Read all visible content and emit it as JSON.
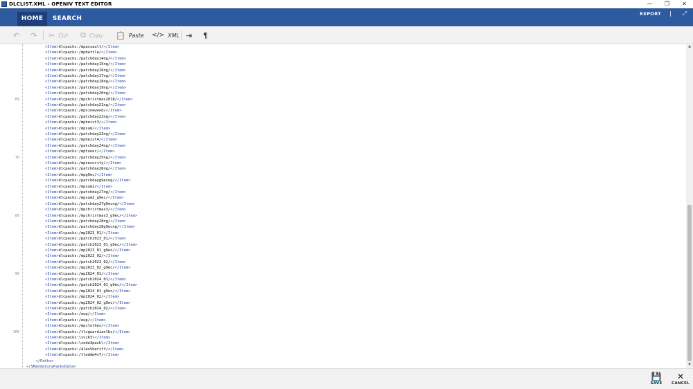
{
  "window": {
    "title": "DLCLIST.XML - OPENIV TEXT EDITOR",
    "minimize_glyph": "—",
    "restore_glyph": "❐",
    "close_glyph": "✕"
  },
  "ribbon": {
    "tabs": [
      {
        "label": "HOME"
      },
      {
        "label": "SEARCH"
      }
    ],
    "export_label": "EXPORT",
    "expand_glyph": "⤢"
  },
  "toolbar": {
    "undo_glyph": "↶",
    "redo_glyph": "↷",
    "cut_label": "Cut",
    "cut_glyph": "✂",
    "copy_label": "Copy",
    "copy_glyph": "⧉",
    "paste_label": "Paste",
    "paste_glyph": "📋",
    "xml_label": "XML",
    "xml_glyph": "</>",
    "wordwrap_glyph": "⇥",
    "pilcrow_glyph": "¶"
  },
  "editor": {
    "line_numbers": [
      "60",
      "70",
      "80",
      "90",
      "100"
    ],
    "lines": [
      {
        "indent": "      ",
        "open": "<Item>",
        "text": "dlcpacks:/mpassault/",
        "close": "</Item>"
      },
      {
        "indent": "      ",
        "open": "<Item>",
        "text": "dlcpacks:/mpbattle/",
        "close": "</Item>"
      },
      {
        "indent": "      ",
        "open": "<Item>",
        "text": "dlcpacks:/patchday14ng/",
        "close": "</Item>"
      },
      {
        "indent": "      ",
        "open": "<Item>",
        "text": "dlcpacks:/patchday15ng/",
        "close": "</Item>"
      },
      {
        "indent": "      ",
        "open": "<Item>",
        "text": "dlcpacks:/patchday16ng/",
        "close": "</Item>"
      },
      {
        "indent": "      ",
        "open": "<Item>",
        "text": "dlcpacks:/patchday17ng/",
        "close": "</Item>"
      },
      {
        "indent": "      ",
        "open": "<Item>",
        "text": "dlcpacks:/patchday18ng/",
        "close": "</Item>"
      },
      {
        "indent": "      ",
        "open": "<Item>",
        "text": "dlcpacks:/patchday19ng/",
        "close": "</Item>"
      },
      {
        "indent": "      ",
        "open": "<Item>",
        "text": "dlcpacks:/patchday20ng/",
        "close": "</Item>"
      },
      {
        "indent": "      ",
        "open": "<Item>",
        "text": "dlcpacks:/mpchristmas2018/",
        "close": "</Item>"
      },
      {
        "indent": "      ",
        "open": "<Item>",
        "text": "dlcpacks:/patchday21ng/",
        "close": "</Item>"
      },
      {
        "indent": "      ",
        "open": "<Item>",
        "text": "dlcpacks:/mpvinewood/",
        "close": "</Item>"
      },
      {
        "indent": "      ",
        "open": "<Item>",
        "text": "dlcpacks:/patchday22ng/",
        "close": "</Item>"
      },
      {
        "indent": "      ",
        "open": "<Item>",
        "text": "dlcpacks:/mpheist3/",
        "close": "</Item>"
      },
      {
        "indent": "      ",
        "open": "<Item>",
        "text": "dlcpacks:/mpsum/",
        "close": "</Item>"
      },
      {
        "indent": "      ",
        "open": "<Item>",
        "text": "dlcpacks:/patchday23ng/",
        "close": "</Item>"
      },
      {
        "indent": "      ",
        "open": "<Item>",
        "text": "dlcpacks:/mpheist4/",
        "close": "</Item>"
      },
      {
        "indent": "      ",
        "open": "<Item>",
        "text": "dlcpacks:/patchday24ng/",
        "close": "</Item>"
      },
      {
        "indent": "      ",
        "open": "<Item>",
        "text": "dlcpacks:/mptuner/",
        "close": "</Item>"
      },
      {
        "indent": "      ",
        "open": "<Item>",
        "text": "dlcpacks:/patchday25ng/",
        "close": "</Item>"
      },
      {
        "indent": "      ",
        "open": "<Item>",
        "text": "dlcpacks:/mpsecurity/",
        "close": "</Item>"
      },
      {
        "indent": "      ",
        "open": "<Item>",
        "text": "dlcpacks:/patchday26ng/",
        "close": "</Item>"
      },
      {
        "indent": "      ",
        "open": "<Item>",
        "text": "dlcpacks:/mpg9ec/",
        "close": "</Item>"
      },
      {
        "indent": "      ",
        "open": "<Item>",
        "text": "dlcpacks:/patchdayg9ecng/",
        "close": "</Item>"
      },
      {
        "indent": "      ",
        "open": "<Item>",
        "text": "dlcpacks:/mpsum2/",
        "close": "</Item>"
      },
      {
        "indent": "      ",
        "open": "<Item>",
        "text": "dlcpacks:/patchday27ng/",
        "close": "</Item>"
      },
      {
        "indent": "      ",
        "open": "<Item>",
        "text": "dlcpacks:/mpsum2_g9ec/",
        "close": "</Item>"
      },
      {
        "indent": "      ",
        "open": "<Item>",
        "text": "dlcpacks:/patchday27g9ecng/",
        "close": "</Item>"
      },
      {
        "indent": "      ",
        "open": "<Item>",
        "text": "dlcpacks:/mpchristmas3/",
        "close": "</Item>"
      },
      {
        "indent": "      ",
        "open": "<Item>",
        "text": "dlcpacks:/mpchristmas3_g9ec/",
        "close": "</Item>"
      },
      {
        "indent": "      ",
        "open": "<Item>",
        "text": "dlcpacks:/patchday28ng/",
        "close": "</Item>"
      },
      {
        "indent": "      ",
        "open": "<Item>",
        "text": "dlcpacks:/patchday28g9ecng/",
        "close": "</Item>"
      },
      {
        "indent": "      ",
        "open": "<Item>",
        "text": "dlcpacks:/mp2023_01/",
        "close": "</Item>"
      },
      {
        "indent": "      ",
        "open": "<Item>",
        "text": "dlcpacks:/patch2023_01/",
        "close": "</Item>"
      },
      {
        "indent": "      ",
        "open": "<Item>",
        "text": "dlcpacks:/patch2023_01_g9ec/",
        "close": "</Item>"
      },
      {
        "indent": "      ",
        "open": "<Item>",
        "text": "dlcpacks:/mp2023_01_g9ec/",
        "close": "</Item>"
      },
      {
        "indent": "      ",
        "open": "<Item>",
        "text": "dlcpacks:/mp2023_02/",
        "close": "</Item>"
      },
      {
        "indent": "      ",
        "open": "<Item>",
        "text": "dlcpacks:/patch2023_02/",
        "close": "</Item>"
      },
      {
        "indent": "      ",
        "open": "<Item>",
        "text": "dlcpacks:/mp2023_02_g9ec/",
        "close": "</Item>"
      },
      {
        "indent": "      ",
        "open": "<Item>",
        "text": "dlcpacks:/mp2024_01/",
        "close": "</Item>"
      },
      {
        "indent": "      ",
        "open": "<Item>",
        "text": "dlcpacks:/patch2024_01/",
        "close": "</Item>"
      },
      {
        "indent": "      ",
        "open": "<Item>",
        "text": "dlcpacks:/patch2024_01_g9ec/",
        "close": "</Item>"
      },
      {
        "indent": "      ",
        "open": "<Item>",
        "text": "dlcpacks:/mp2024_01_g9ec/",
        "close": "</Item>"
      },
      {
        "indent": "      ",
        "open": "<Item>",
        "text": "dlcpacks:/mp2024_02/",
        "close": "</Item>"
      },
      {
        "indent": "      ",
        "open": "<Item>",
        "text": "dlcpacks:/mp2024_02_g9ec/",
        "close": "</Item>"
      },
      {
        "indent": "      ",
        "open": "<Item>",
        "text": "dlcpacks:/patch2024_02/",
        "close": "</Item>"
      },
      {
        "indent": "      ",
        "open": "<Item>",
        "text": "dlcpacks:/eup/",
        "close": "</Item>"
      },
      {
        "indent": "      ",
        "open": "<Item>",
        "text": "dlcpacks:/eup/",
        "close": "</Item>"
      },
      {
        "indent": "      ",
        "open": "<Item>",
        "text": "dlcpacks:/mpclothes/",
        "close": "</Item>"
      },
      {
        "indent": "      ",
        "open": "<Item>",
        "text": "dlcpacks:/tlsguardianlbv/",
        "close": "</Item>"
      },
      {
        "indent": "      ",
        "open": "<Item>",
        "text": "dlcpacks:\\svj63\\",
        "close": "</Item>"
      },
      {
        "indent": "      ",
        "open": "<Item>",
        "text": "dlcpacks:\\code3pack\\",
        "close": "</Item>"
      },
      {
        "indent": "      ",
        "open": "<Item>",
        "text": "dlcpacks:/AlexSheriff/",
        "close": "</Item>"
      },
      {
        "indent": "      ",
        "open": "<Item>",
        "text": "dlcpacks:/tleddm4v7/",
        "close": "</Item>"
      },
      {
        "indent": "   ",
        "open": "</Paths>",
        "text": "",
        "close": ""
      },
      {
        "indent": "",
        "open": "</SMandatoryPacksData>",
        "text": "",
        "close": ""
      }
    ]
  },
  "bottombar": {
    "save_label": "SAVE",
    "save_glyph": "💾",
    "cancel_label": "CANCEL",
    "cancel_glyph": "✕"
  },
  "colors": {
    "accent": "#2e5aa0",
    "active_tab": "#1f3f7a",
    "xml_tag": "#1f3f9f"
  }
}
